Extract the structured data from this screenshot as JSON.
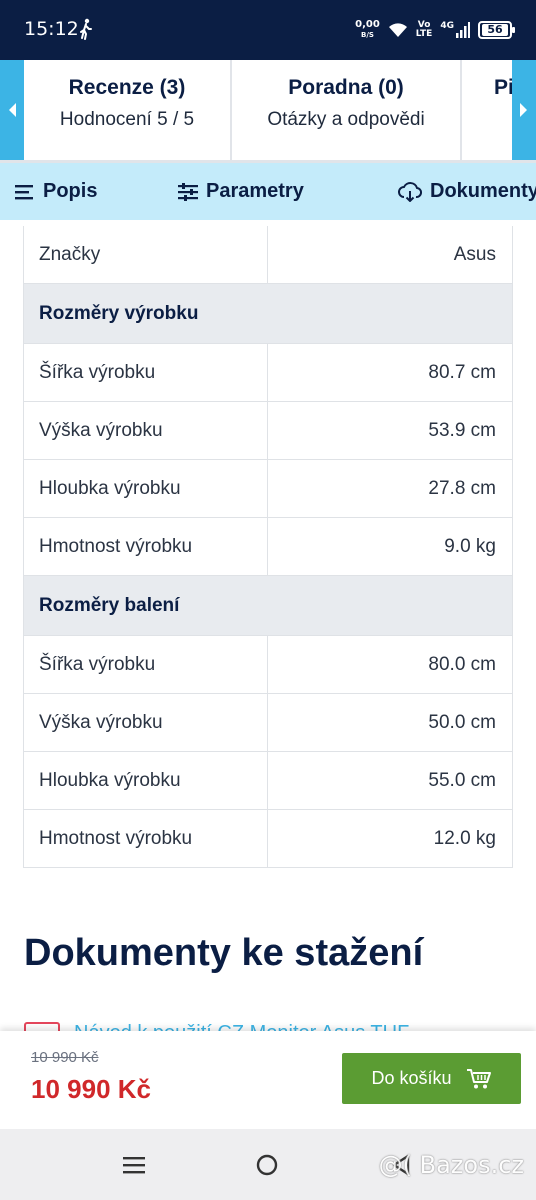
{
  "status": {
    "time": "15:12",
    "net_speed": "0,00",
    "net_unit": "B/S",
    "volte_top": "Vo",
    "volte_bottom": "LTE",
    "network": "4G",
    "battery": "56"
  },
  "top_tabs": [
    {
      "title": "Recenze (3)",
      "subtitle": "Hodnocení 5 / 5"
    },
    {
      "title": "Poradna (0)",
      "subtitle": "Otázky a odpovědi"
    },
    {
      "title": "Pi",
      "subtitle": ""
    }
  ],
  "subnav": {
    "popis": "Popis",
    "parametry": "Parametry",
    "dokumenty": "Dokumenty"
  },
  "params": {
    "brand_row": {
      "key": "Značky",
      "value": "Asus"
    },
    "product_dims_header": "Rozměry výrobku",
    "product_dims": [
      {
        "key": "Šířka výrobku",
        "value": "80.7 cm"
      },
      {
        "key": "Výška výrobku",
        "value": "53.9 cm"
      },
      {
        "key": "Hloubka výrobku",
        "value": "27.8 cm"
      },
      {
        "key": "Hmotnost výrobku",
        "value": "9.0 kg"
      }
    ],
    "package_dims_header": "Rozměry balení",
    "package_dims": [
      {
        "key": "Šířka výrobku",
        "value": "80.0 cm"
      },
      {
        "key": "Výška výrobku",
        "value": "50.0 cm"
      },
      {
        "key": "Hloubka výrobku",
        "value": "55.0 cm"
      },
      {
        "key": "Hmotnost výrobku",
        "value": "12.0 kg"
      }
    ]
  },
  "documents": {
    "title": "Dokumenty ke stažení",
    "link": "Návod k použití CZ Monitor Asus TUF"
  },
  "price": {
    "old": "10 990 Kč",
    "current": "10 990 Kč",
    "cart_label": "Do košíku"
  },
  "watermark": "@( Bazos.cz",
  "colors": {
    "navy": "#0b1e44",
    "accent_blue": "#3cb4e5",
    "subnav_bg": "#c4ebfa",
    "price_red": "#d0282a",
    "cart_green": "#5b9c33"
  }
}
